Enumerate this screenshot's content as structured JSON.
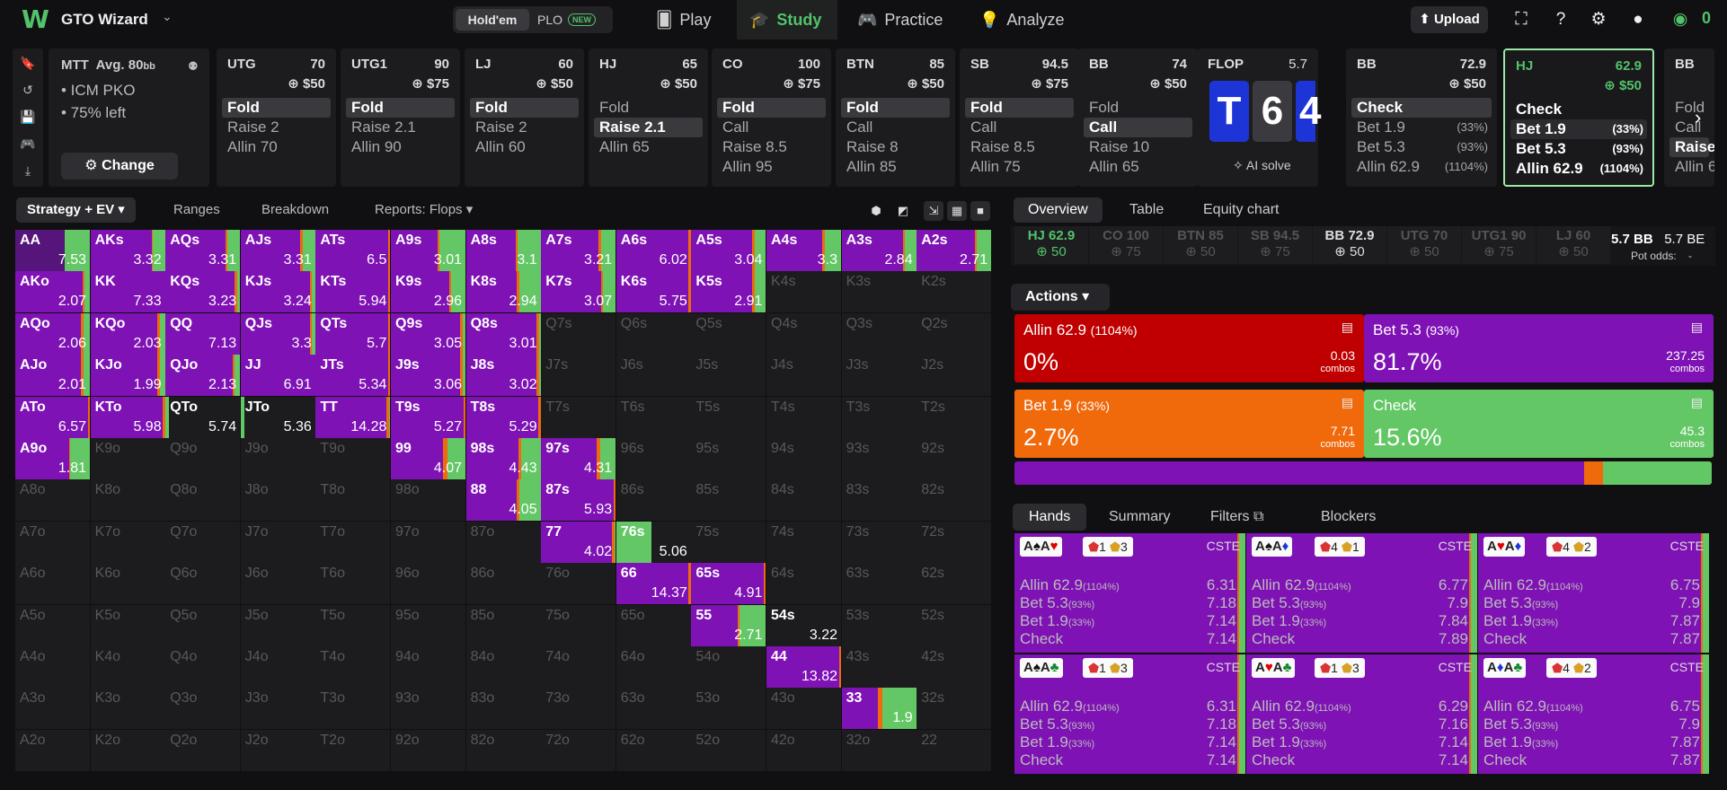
{
  "top": {
    "brand": "GTO Wizard",
    "game_on": "Hold'em",
    "game_off": "PLO",
    "new_badge": "NEW",
    "nav": [
      "Play",
      "Study",
      "Practice",
      "Analyze"
    ],
    "active_nav": "Study",
    "upload": "Upload",
    "coins": "0"
  },
  "settings": {
    "title": "MTT",
    "avg": "Avg. 80",
    "avg_unit": "bb",
    "lines": [
      "• ICM PKO",
      "• 75% left"
    ],
    "change": "Change"
  },
  "positions": [
    {
      "pos": "UTG",
      "stack": "70",
      "prize": "$50",
      "actions": [
        {
          "label": "Fold",
          "sel": true
        },
        {
          "label": "Raise 2"
        },
        {
          "label": "Allin 70"
        }
      ]
    },
    {
      "pos": "UTG1",
      "stack": "90",
      "prize": "$75",
      "actions": [
        {
          "label": "Fold",
          "sel": true
        },
        {
          "label": "Raise 2.1"
        },
        {
          "label": "Allin 90"
        }
      ]
    },
    {
      "pos": "LJ",
      "stack": "60",
      "prize": "$50",
      "actions": [
        {
          "label": "Fold",
          "sel": true
        },
        {
          "label": "Raise 2"
        },
        {
          "label": "Allin 60"
        }
      ]
    },
    {
      "pos": "HJ",
      "stack": "65",
      "prize": "$50",
      "actions": [
        {
          "label": "Fold"
        },
        {
          "label": "Raise 2.1",
          "sel": true
        },
        {
          "label": "Allin 65"
        }
      ]
    },
    {
      "pos": "CO",
      "stack": "100",
      "prize": "$75",
      "actions": [
        {
          "label": "Fold",
          "sel": true
        },
        {
          "label": "Call"
        },
        {
          "label": "Raise 8.5"
        },
        {
          "label": "Allin 95"
        }
      ]
    },
    {
      "pos": "BTN",
      "stack": "85",
      "prize": "$50",
      "actions": [
        {
          "label": "Fold",
          "sel": true
        },
        {
          "label": "Call"
        },
        {
          "label": "Raise 8"
        },
        {
          "label": "Allin 85"
        }
      ]
    },
    {
      "pos": "SB",
      "stack": "94.5",
      "prize": "$75",
      "actions": [
        {
          "label": "Fold",
          "sel": true
        },
        {
          "label": "Call"
        },
        {
          "label": "Raise 8.5"
        },
        {
          "label": "Allin 75"
        }
      ]
    },
    {
      "pos": "BB",
      "stack": "74",
      "prize": "$50",
      "actions": [
        {
          "label": "Fold"
        },
        {
          "label": "Call",
          "sel": true
        },
        {
          "label": "Raise 10"
        },
        {
          "label": "Allin 65"
        }
      ]
    }
  ],
  "flop": {
    "title": "FLOP",
    "pot": "5.7",
    "cards": [
      "T",
      "6",
      "4"
    ],
    "ai_solve": "AI solve"
  },
  "postflop": [
    {
      "pos": "BB",
      "stack": "72.9",
      "prize": "$50",
      "actions": [
        {
          "label": "Check",
          "sel": true
        },
        {
          "label": "Bet 1.9",
          "pct": "(33%)"
        },
        {
          "label": "Bet 5.3",
          "pct": "(93%)"
        },
        {
          "label": "Allin 62.9",
          "pct": "(1104%)"
        }
      ]
    },
    {
      "pos": "HJ",
      "stack": "62.9",
      "prize": "$50",
      "active": true,
      "actions": [
        {
          "label": "Check"
        },
        {
          "label": "Bet 1.9",
          "pct": "(33%)",
          "sel": true
        },
        {
          "label": "Bet 5.3",
          "pct": "(93%)"
        },
        {
          "label": "Allin 62.9",
          "pct": "(1104%)"
        }
      ]
    },
    {
      "pos": "BB",
      "stack": "",
      "prize": "",
      "actions": [
        {
          "label": "Fold"
        },
        {
          "label": "Call"
        },
        {
          "label": "Raise",
          "sel": true
        },
        {
          "label": "Allin 6"
        }
      ]
    }
  ],
  "strategy_tabs": [
    "Strategy + EV",
    "Ranges",
    "Breakdown",
    "Reports: Flops"
  ],
  "colors": {
    "allin": "#c00000",
    "bet53": "#7e12b5",
    "bet19": "#f06a0c",
    "check": "#64c766"
  },
  "grid_ranks": [
    "A",
    "K",
    "Q",
    "J",
    "T",
    "9",
    "8",
    "7",
    "6",
    "5",
    "4",
    "3",
    "2"
  ],
  "grid_cells": {
    "AA": {
      "v": "7.53",
      "s": [
        0,
        0.66,
        0,
        0.34
      ],
      "dark": true
    },
    "AKs": {
      "v": "3.32",
      "s": [
        0,
        0.82,
        0.02,
        0.16
      ]
    },
    "AQs": {
      "v": "3.31",
      "s": [
        0,
        0.8,
        0.03,
        0.17
      ]
    },
    "AJs": {
      "v": "3.31",
      "s": [
        0,
        0.8,
        0.03,
        0.17
      ]
    },
    "ATs": {
      "v": "6.5",
      "s": [
        0,
        0.97,
        0.03,
        0
      ]
    },
    "A9s": {
      "v": "3.01",
      "s": [
        0,
        0.63,
        0.02,
        0.35
      ]
    },
    "A8s": {
      "v": "3.1",
      "s": [
        0,
        0.67,
        0.02,
        0.31
      ]
    },
    "A7s": {
      "v": "3.21",
      "s": [
        0,
        0.77,
        0.03,
        0.2
      ]
    },
    "A6s": {
      "v": "6.02",
      "s": [
        0,
        0.97,
        0.03,
        0
      ]
    },
    "A5s": {
      "v": "3.04",
      "s": [
        0,
        0.82,
        0.03,
        0.15
      ]
    },
    "A4s": {
      "v": "3.3",
      "s": [
        0,
        0.75,
        0.03,
        0.22
      ]
    },
    "A3s": {
      "v": "2.84",
      "s": [
        0,
        0.82,
        0.03,
        0.15
      ]
    },
    "A2s": {
      "v": "2.71",
      "s": [
        0,
        0.78,
        0.03,
        0.19
      ]
    },
    "AKo": {
      "v": "2.07",
      "s": [
        0,
        0.9,
        0.03,
        0.07
      ]
    },
    "KK": {
      "v": "7.33",
      "s": [
        0,
        1,
        0,
        0
      ]
    },
    "KQs": {
      "v": "3.23",
      "s": [
        0,
        0.93,
        0.03,
        0.04
      ]
    },
    "KJs": {
      "v": "3.24",
      "s": [
        0,
        0.93,
        0.03,
        0.04
      ]
    },
    "KTs": {
      "v": "5.94",
      "s": [
        0,
        0.97,
        0.03,
        0
      ]
    },
    "K9s": {
      "v": "2.96",
      "s": [
        0,
        0.78,
        0.03,
        0.19
      ]
    },
    "K8s": {
      "v": "2.94",
      "s": [
        0,
        0.68,
        0.03,
        0.29
      ]
    },
    "K7s": {
      "v": "3.07",
      "s": [
        0,
        0.8,
        0.03,
        0.17
      ]
    },
    "K6s": {
      "v": "5.75",
      "s": [
        0,
        0.97,
        0.03,
        0
      ]
    },
    "K5s": {
      "v": "2.91",
      "s": [
        0,
        0.82,
        0.03,
        0.15
      ]
    },
    "AQo": {
      "v": "2.06",
      "s": [
        0,
        0.88,
        0.04,
        0.08
      ]
    },
    "KQo": {
      "v": "2.03",
      "s": [
        0,
        0.9,
        0.03,
        0.07
      ]
    },
    "QQ": {
      "v": "7.13",
      "s": [
        0,
        1,
        0,
        0
      ]
    },
    "QJs": {
      "v": "3.3",
      "s": [
        0,
        0.93,
        0.03,
        0.04
      ]
    },
    "QTs": {
      "v": "5.7",
      "s": [
        0,
        0.97,
        0.03,
        0
      ]
    },
    "Q9s": {
      "v": "3.05",
      "s": [
        0,
        0.93,
        0.03,
        0.04
      ]
    },
    "Q8s": {
      "v": "3.01",
      "s": [
        0,
        0.95,
        0.03,
        0.02
      ]
    },
    "AJo": {
      "v": "2.01",
      "s": [
        0,
        0.88,
        0.04,
        0.08
      ]
    },
    "KJo": {
      "v": "1.99",
      "s": [
        0,
        0.9,
        0.03,
        0.07
      ]
    },
    "QJo": {
      "v": "2.13",
      "s": [
        0,
        0.9,
        0.03,
        0.07
      ]
    },
    "JJ": {
      "v": "6.91",
      "s": [
        0,
        1,
        0,
        0
      ]
    },
    "JTs": {
      "v": "5.34",
      "s": [
        0,
        0.97,
        0.03,
        0
      ]
    },
    "J9s": {
      "v": "3.06",
      "s": [
        0,
        0.93,
        0.03,
        0.04
      ]
    },
    "J8s": {
      "v": "3.02",
      "s": [
        0,
        0.95,
        0.03,
        0.02
      ]
    },
    "ATo": {
      "v": "6.57",
      "s": [
        0,
        0.97,
        0.03,
        0
      ]
    },
    "KTo": {
      "v": "5.98",
      "s": [
        0,
        0.97,
        0.03,
        0
      ]
    },
    "QTo": {
      "v": "5.74",
      "s": [
        0,
        0,
        0,
        0.05
      ]
    },
    "JTo": {
      "v": "5.36",
      "s": [
        0,
        0,
        0,
        0.05
      ]
    },
    "TT": {
      "v": "14.28",
      "s": [
        0,
        0.95,
        0.03,
        0.02
      ]
    },
    "T9s": {
      "v": "5.27",
      "s": [
        0,
        0.97,
        0.03,
        0
      ]
    },
    "T8s": {
      "v": "5.29",
      "s": [
        0,
        0.97,
        0.03,
        0
      ]
    },
    "A9o": {
      "v": "1.81",
      "s": [
        0,
        0.72,
        0.02,
        0.26
      ]
    },
    "99": {
      "v": "4.07",
      "s": [
        0,
        0.7,
        0.06,
        0.24
      ]
    },
    "98s": {
      "v": "4.43",
      "s": [
        0,
        0.7,
        0.04,
        0.26
      ]
    },
    "97s": {
      "v": "4.31",
      "s": [
        0,
        0.75,
        0.04,
        0.21
      ]
    },
    "88": {
      "v": "4.05",
      "s": [
        0,
        0.68,
        0.04,
        0.28
      ]
    },
    "87s": {
      "v": "5.93",
      "s": [
        0,
        0.97,
        0.03,
        0
      ]
    },
    "77": {
      "v": "4.02",
      "s": [
        0,
        0.95,
        0.03,
        0.02
      ]
    },
    "76s": {
      "v": "5.06",
      "s": [
        0,
        0,
        0,
        0.47
      ]
    },
    "66": {
      "v": "14.37",
      "s": [
        0,
        0.97,
        0.03,
        0
      ]
    },
    "65s": {
      "v": "4.91",
      "s": [
        0,
        0.97,
        0.03,
        0
      ]
    },
    "55": {
      "v": "2.71",
      "s": [
        0,
        0.62,
        0.03,
        0.35
      ]
    },
    "54s": {
      "v": "3.22",
      "s": [
        0,
        0,
        0,
        0
      ]
    },
    "44": {
      "v": "13.82",
      "s": [
        0,
        0.97,
        0.03,
        0
      ]
    },
    "33": {
      "v": "1.9",
      "s": [
        0,
        0.49,
        0.06,
        0.45
      ]
    }
  },
  "overview_tabs": [
    "Overview",
    "Table",
    "Equity chart"
  ],
  "stacks": [
    {
      "pos": "HJ 62.9",
      "prize": "50"
    },
    {
      "pos": "CO 100",
      "prize": "75"
    },
    {
      "pos": "BTN 85",
      "prize": "50"
    },
    {
      "pos": "SB 94.5",
      "prize": "75"
    },
    {
      "pos": "BB 72.9",
      "prize": "50"
    },
    {
      "pos": "UTG 70",
      "prize": "50"
    },
    {
      "pos": "UTG1 90",
      "prize": "75"
    },
    {
      "pos": "LJ 60",
      "prize": "50"
    }
  ],
  "pot": {
    "value": "5.7 BB",
    "extra": "5.7 BE",
    "odds_label": "Pot odds:",
    "odds_value": "-"
  },
  "actions_label": "Actions",
  "action_boxes": [
    {
      "title": "Allin 62.9",
      "sub": "(1104%)",
      "pct": "0%",
      "combos": "0.03",
      "unit": "combos",
      "color": "#c00000"
    },
    {
      "title": "Bet 5.3",
      "sub": "(93%)",
      "pct": "81.7%",
      "combos": "237.25",
      "unit": "combos",
      "color": "#7e12b5"
    },
    {
      "title": "Bet 1.9",
      "sub": "(33%)",
      "pct": "2.7%",
      "combos": "7.71",
      "unit": "combos",
      "color": "#f06a0c"
    },
    {
      "title": "Check",
      "sub": "",
      "pct": "15.6%",
      "combos": "45.3",
      "unit": "combos",
      "color": "#64c766"
    }
  ],
  "distribution": [
    0,
    0.817,
    0.027,
    0.156
  ],
  "hand_tabs": [
    "Hands",
    "Summary",
    "Filters",
    "Blockers"
  ],
  "hands": [
    {
      "c1": "A",
      "s1": "♠",
      "sc1": "k",
      "c2": "A",
      "s2": "♥",
      "sc2": "r",
      "b1": "1",
      "b2": "3",
      "vals": [
        "6.31",
        "7.18",
        "7.14",
        "7.14"
      ],
      "strip": [
        0.0,
        0.35,
        0.15,
        0.5
      ]
    },
    {
      "c1": "A",
      "s1": "♠",
      "sc1": "k",
      "c2": "A",
      "s2": "♦",
      "sc2": "b",
      "b1": "4",
      "b2": "1",
      "vals": [
        "6.77",
        "7.9",
        "7.84",
        "7.89"
      ],
      "strip": [
        0.0,
        0.35,
        0.15,
        0.5
      ]
    },
    {
      "c1": "A",
      "s1": "♥",
      "sc1": "r",
      "c2": "A",
      "s2": "♦",
      "sc2": "b",
      "b1": "4",
      "b2": "2",
      "vals": [
        "6.75",
        "7.9",
        "7.87",
        "7.87"
      ],
      "strip": [
        0.0,
        0.35,
        0.15,
        0.5
      ]
    },
    {
      "c1": "A",
      "s1": "♠",
      "sc1": "k",
      "c2": "A",
      "s2": "♣",
      "sc2": "g",
      "b1": "1",
      "b2": "3",
      "vals": [
        "6.31",
        "7.18",
        "7.14",
        "7.14"
      ],
      "strip": [
        0.0,
        0.35,
        0.15,
        0.5
      ]
    },
    {
      "c1": "A",
      "s1": "♥",
      "sc1": "r",
      "c2": "A",
      "s2": "♣",
      "sc2": "g",
      "b1": "1",
      "b2": "3",
      "vals": [
        "6.29",
        "7.16",
        "7.14",
        "7.14"
      ],
      "strip": [
        0.0,
        0.35,
        0.15,
        0.5
      ]
    },
    {
      "c1": "A",
      "s1": "♦",
      "sc1": "b",
      "c2": "A",
      "s2": "♣",
      "sc2": "g",
      "b1": "4",
      "b2": "2",
      "vals": [
        "6.75",
        "7.9",
        "7.87",
        "7.87"
      ],
      "strip": [
        0.0,
        0.35,
        0.15,
        0.5
      ]
    }
  ],
  "hand_lines": [
    {
      "label": "Allin 62.9",
      "sub": "(1104%)"
    },
    {
      "label": "Bet 5.3",
      "sub": "(93%)"
    },
    {
      "label": "Bet 1.9",
      "sub": "(33%)"
    },
    {
      "label": "Check",
      "sub": ""
    }
  ],
  "cste": "CSTE"
}
